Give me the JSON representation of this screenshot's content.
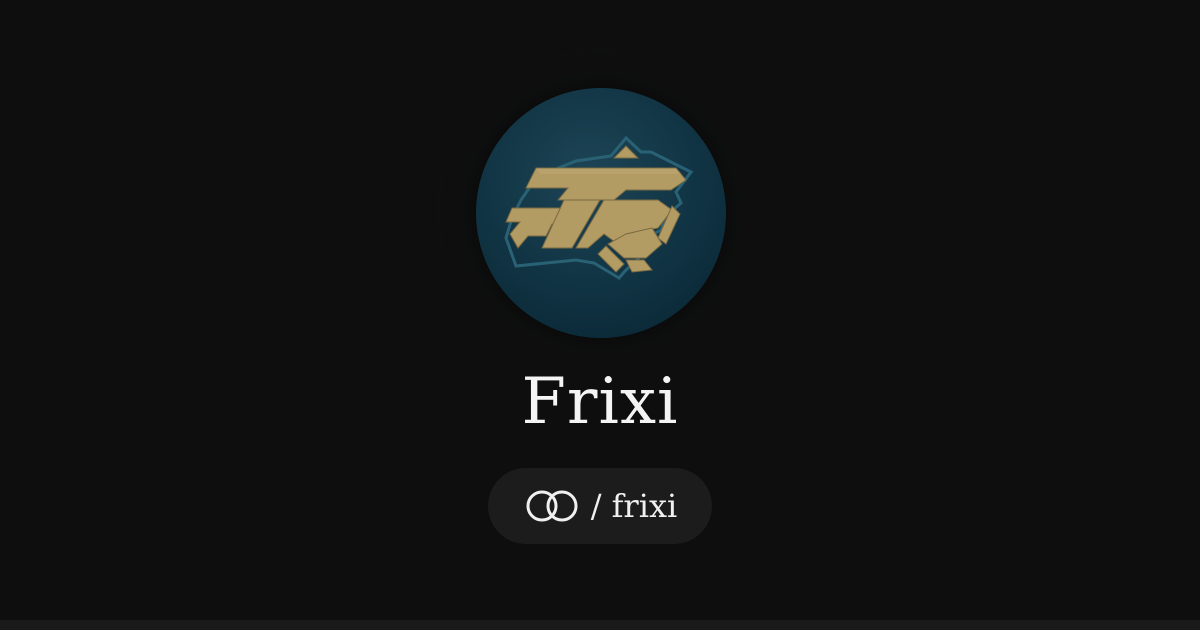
{
  "profile": {
    "name": "Frixi",
    "handle_separator": "/",
    "handle": "frixi",
    "avatar_icon": "fr-logo-icon",
    "link_icon": "linked-rings-icon"
  },
  "colors": {
    "background": "#0e0e0e",
    "avatar_background": "#123646",
    "logo_gold": "#b8a06a",
    "pill_background": "#1c1c1c",
    "text": "#f4f4f4"
  }
}
